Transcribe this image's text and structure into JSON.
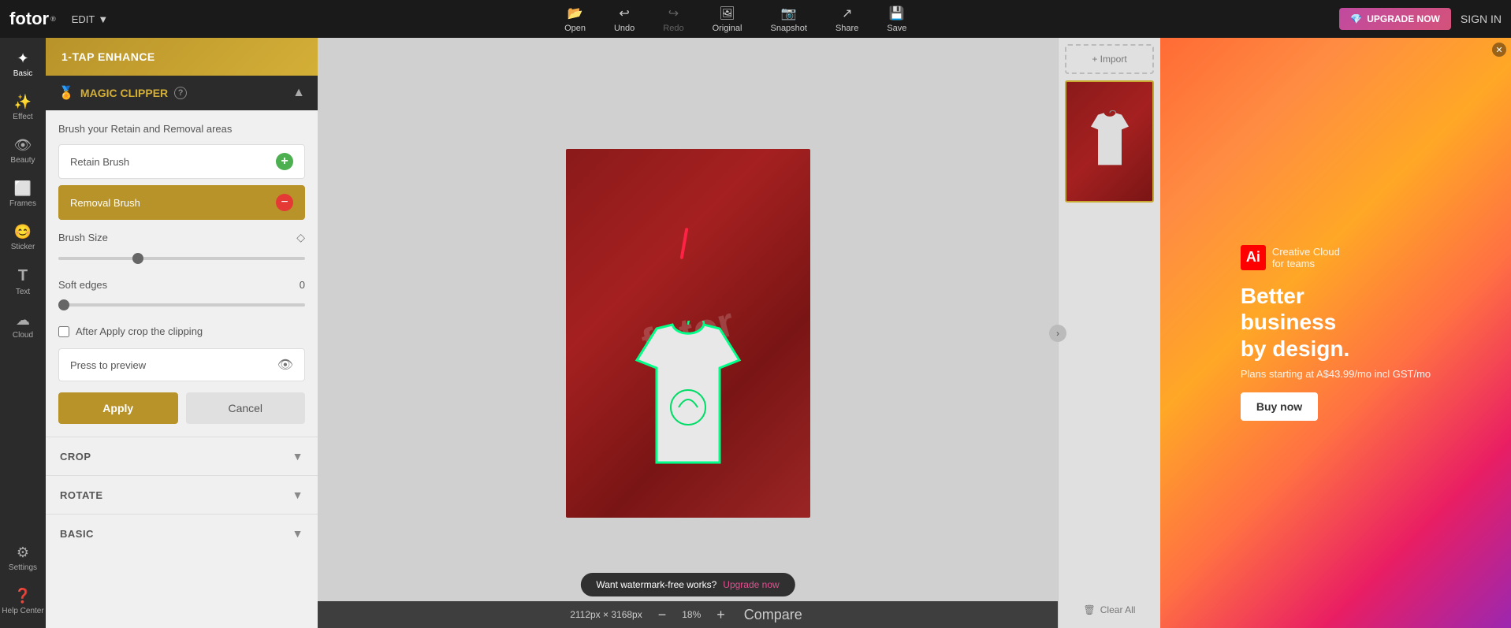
{
  "topbar": {
    "logo": "fotor",
    "logo_sup": "®",
    "edit_label": "EDIT",
    "tools": [
      {
        "id": "open",
        "label": "Open",
        "icon": "📂"
      },
      {
        "id": "undo",
        "label": "Undo",
        "icon": "↩"
      },
      {
        "id": "redo",
        "label": "Redo",
        "icon": "↪"
      },
      {
        "id": "original",
        "label": "Original",
        "icon": "🖼"
      },
      {
        "id": "snapshot",
        "label": "Snapshot",
        "icon": "📷"
      },
      {
        "id": "share",
        "label": "Share",
        "icon": "↗"
      },
      {
        "id": "save",
        "label": "Save",
        "icon": "💾"
      }
    ],
    "upgrade_label": "UPGRADE NOW",
    "signin_label": "SIGN IN"
  },
  "icon_nav": {
    "items": [
      {
        "id": "basic",
        "label": "Basic",
        "icon": "✦",
        "active": true
      },
      {
        "id": "effect",
        "label": "Effect",
        "icon": "✨"
      },
      {
        "id": "beauty",
        "label": "Beauty",
        "icon": "👁"
      },
      {
        "id": "frames",
        "label": "Frames",
        "icon": "⬜"
      },
      {
        "id": "sticker",
        "label": "Sticker",
        "icon": "😊"
      },
      {
        "id": "text",
        "label": "Text",
        "icon": "T"
      },
      {
        "id": "cloud",
        "label": "Cloud",
        "icon": "☁"
      },
      {
        "id": "settings",
        "label": "Settings",
        "icon": "⚙"
      },
      {
        "id": "help",
        "label": "Help Center",
        "icon": "?"
      }
    ]
  },
  "left_panel": {
    "one_tap_enhance": "1-TAP ENHANCE",
    "magic_clipper": {
      "title": "MAGIC CLIPPER",
      "help_tooltip": "?",
      "brush_instruction": "Brush your Retain and Removal areas",
      "retain_brush_label": "Retain Brush",
      "removal_brush_label": "Removal Brush",
      "brush_size_label": "Brush Size",
      "brush_size_value": "",
      "soft_edges_label": "Soft edges",
      "soft_edges_value": "0",
      "checkbox_label": "After Apply crop the clipping",
      "preview_placeholder": "Press to preview",
      "apply_label": "Apply",
      "cancel_label": "Cancel"
    },
    "crop_label": "CROP",
    "rotate_label": "ROTATE",
    "basic_label": "BASIC"
  },
  "canvas": {
    "watermark": "fotor",
    "upgrade_message": "Want watermark-free works? Upgrade now",
    "upgrade_link": "Upgrade now",
    "dimensions": "2112px × 3168px",
    "zoom": "18%",
    "compare_label": "Compare"
  },
  "right_panel": {
    "import_label": "+ Import",
    "clear_all_label": "Clear All"
  },
  "ad": {
    "title": "Better\nbusiness\nby design.",
    "subtitle": "Plans starting at A$43.99/mo incl GST/mo",
    "buy_label": "Buy now",
    "product_name": "Creative Cloud\nfor teams"
  }
}
